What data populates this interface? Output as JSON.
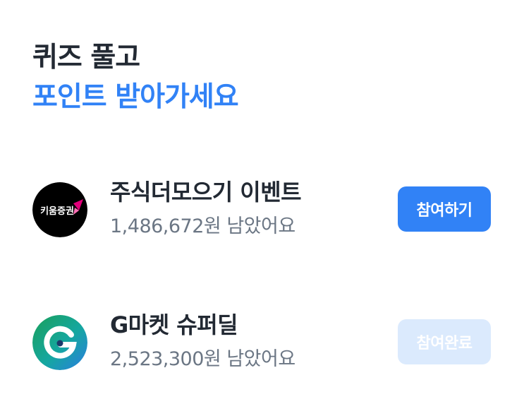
{
  "heading": {
    "line1": "퀴즈 풀고",
    "line2": "포인트 받아가세요"
  },
  "events": [
    {
      "logo_icon": "kiwoom-securities-logo",
      "logo_text": "키움증권",
      "title": "주식더모으기 이벤트",
      "remaining": "1,486,672원 남았어요",
      "button_label": "참여하기",
      "button_state": "active"
    },
    {
      "logo_icon": "gmarket-logo",
      "title": "G마켓 슈퍼딜",
      "remaining": "2,523,300원 남았어요",
      "button_label": "참여완료",
      "button_state": "completed"
    }
  ],
  "colors": {
    "accent": "#3182f6",
    "title_text": "#222933",
    "sub_text": "#6b7684",
    "done_button": "#dbeafd",
    "kiwoom_logo_bg": "#000000",
    "kiwoom_logo_accent": "#e2007a",
    "gmarket_gradient_start": "#1a9f5a",
    "gmarket_gradient_end": "#2a7de1"
  }
}
